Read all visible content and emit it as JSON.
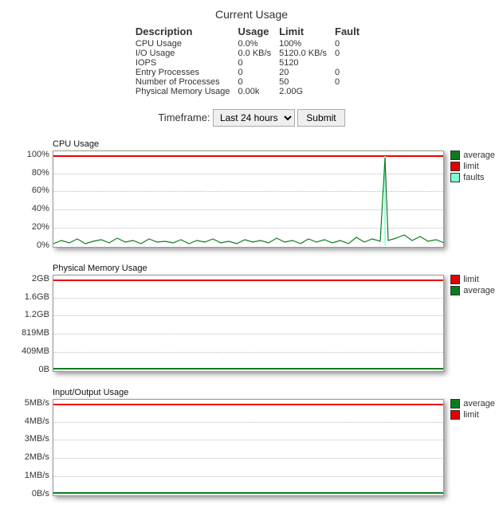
{
  "title": "Current Usage",
  "table": {
    "headers": {
      "desc": "Description",
      "usage": "Usage",
      "limit": "Limit",
      "fault": "Fault"
    },
    "rows": [
      {
        "desc": "CPU Usage",
        "usage": "0.0%",
        "limit": "100%",
        "fault": "0"
      },
      {
        "desc": "I/O Usage",
        "usage": "0.0 KB/s",
        "limit": "5120.0 KB/s",
        "fault": "0"
      },
      {
        "desc": "IOPS",
        "usage": "0",
        "limit": "5120",
        "fault": ""
      },
      {
        "desc": "Entry Processes",
        "usage": "0",
        "limit": "20",
        "fault": "0"
      },
      {
        "desc": "Number of Processes",
        "usage": "0",
        "limit": "50",
        "fault": "0"
      },
      {
        "desc": "Physical Memory Usage",
        "usage": "0.00k",
        "limit": "2.00G",
        "fault": ""
      }
    ]
  },
  "controls": {
    "label": "Timeframe:",
    "select_value": "Last 24 hours",
    "submit": "Submit"
  },
  "charts": {
    "cpu": {
      "title": "CPU Usage",
      "ticks": [
        "100%",
        "80%",
        "60%",
        "40%",
        "20%",
        "0%"
      ],
      "legend": [
        {
          "name": "average",
          "color": "#0a7c1f"
        },
        {
          "name": "limit",
          "color": "#e00000"
        },
        {
          "name": "faults",
          "color": "#7fffd4"
        }
      ]
    },
    "mem": {
      "title": "Physical Memory Usage",
      "ticks": [
        "2GB",
        "1.6GB",
        "1.2GB",
        "819MB",
        "409MB",
        "0B"
      ],
      "legend": [
        {
          "name": "limit",
          "color": "#e00000"
        },
        {
          "name": "average",
          "color": "#0a7c1f"
        }
      ]
    },
    "io": {
      "title": "Input/Output Usage",
      "ticks": [
        "5MB/s",
        "4MB/s",
        "3MB/s",
        "2MB/s",
        "1MB/s",
        "0B/s"
      ],
      "legend": [
        {
          "name": "average",
          "color": "#0a7c1f"
        },
        {
          "name": "limit",
          "color": "#e00000"
        }
      ]
    }
  },
  "chart_data": [
    {
      "type": "line",
      "title": "CPU Usage",
      "xlabel": "",
      "ylabel": "",
      "ylim": [
        0,
        100
      ],
      "series": [
        {
          "name": "limit",
          "values_note": "constant 100%"
        },
        {
          "name": "average",
          "values_note": "noisy near 0-10% with one spike near 100% around x≈0.85 of width"
        },
        {
          "name": "faults",
          "values_note": "single spike coincident with average spike"
        }
      ]
    },
    {
      "type": "line",
      "title": "Physical Memory Usage",
      "xlabel": "",
      "ylabel": "",
      "ylim": [
        0,
        2048
      ],
      "series": [
        {
          "name": "limit",
          "values_note": "constant 2GB"
        },
        {
          "name": "average",
          "values_note": "near 0 flat"
        }
      ]
    },
    {
      "type": "line",
      "title": "Input/Output Usage",
      "xlabel": "",
      "ylabel": "",
      "ylim": [
        0,
        5
      ],
      "series": [
        {
          "name": "limit",
          "values_note": "constant 5MB/s"
        },
        {
          "name": "average",
          "values_note": "near 0 flat"
        }
      ]
    }
  ]
}
